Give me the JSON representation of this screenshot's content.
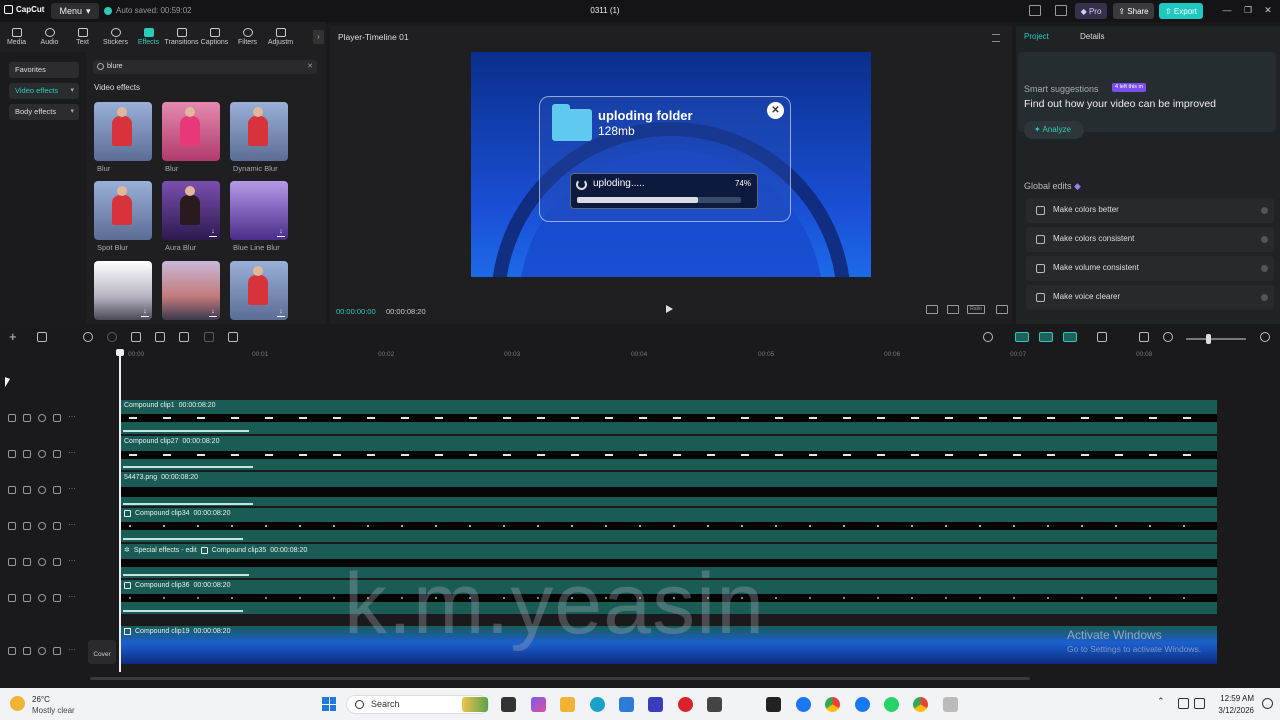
{
  "app": {
    "name": "CapCut",
    "menu_label": "Menu",
    "autosave": "Auto saved: 00:59:02",
    "project_title": "0311 (1)",
    "pro_label": "Pro",
    "share_label": "Share",
    "export_label": "Export"
  },
  "tool_tabs": [
    {
      "label": "Media",
      "icon": "media-icon"
    },
    {
      "label": "Audio",
      "icon": "audio-icon"
    },
    {
      "label": "Text",
      "icon": "text-icon"
    },
    {
      "label": "Stickers",
      "icon": "stickers-icon"
    },
    {
      "label": "Effects",
      "icon": "effects-icon",
      "active": true
    },
    {
      "label": "Transitions",
      "icon": "transitions-icon"
    },
    {
      "label": "Captions",
      "icon": "captions-icon"
    },
    {
      "label": "Filters",
      "icon": "filters-icon"
    },
    {
      "label": "Adjustm",
      "icon": "adjust-icon"
    }
  ],
  "categories": {
    "favorites": "Favorites",
    "video_effects": "Video effects",
    "body_effects": "Body effects"
  },
  "search": {
    "value": "blure"
  },
  "effects_section_title": "Video effects",
  "effects": [
    {
      "label": "Blur"
    },
    {
      "label": "Blur"
    },
    {
      "label": "Dynamic Blur"
    },
    {
      "label": "Spot Blur"
    },
    {
      "label": "Aura Blur"
    },
    {
      "label": "Blue Line Blur"
    },
    {
      "label": ""
    },
    {
      "label": ""
    },
    {
      "label": ""
    }
  ],
  "player": {
    "title": "Player-Timeline 01",
    "current_time": "00:00:00:00",
    "total_time": "00:00:08:20",
    "ratio_label": "Ratio"
  },
  "upload_dialog": {
    "title": "uploding folder",
    "size": "128mb",
    "status": "uploding.....",
    "percent_label": "74%",
    "progress": 0.74
  },
  "right_panel": {
    "tab_project": "Project",
    "tab_details": "Details",
    "suggest_title": "Smart suggestions",
    "suggest_badge": "4 left this m",
    "suggest_text": "Find out how your video can be improved",
    "analyze_label": "Analyze",
    "global_title": "Global edits",
    "global_items": [
      "Make colors better",
      "Make colors consistent",
      "Make volume consistent",
      "Make voice clearer"
    ]
  },
  "ruler_labels": [
    "00:00",
    "00:01",
    "00:02",
    "00:03",
    "00:04",
    "00:05",
    "00:06",
    "00:07",
    "00:08"
  ],
  "tracks": [
    {
      "label": "Compound clip1",
      "time": "00:00:08:20"
    },
    {
      "label": "Compound clip27",
      "time": "00:00:08:20"
    },
    {
      "label": "54473.png",
      "time": "00:00:08:20"
    },
    {
      "label": "Compound clip34",
      "time": "00:00:08:20"
    },
    {
      "label": "Compound clip35",
      "time": "00:00:08:20",
      "prefix": "Special effects - edit"
    },
    {
      "label": "Compound clip36",
      "time": "00:00:08:20"
    },
    {
      "label": "Compound clip19",
      "time": "00:00:08:20"
    }
  ],
  "cover_label": "Cover",
  "watermark": "k.m.yeasin",
  "activate": {
    "title": "Activate Windows",
    "subtitle": "Go to Settings to activate Windows."
  },
  "taskbar": {
    "temperature": "26°C",
    "condition": "Mostly clear",
    "search_placeholder": "Search",
    "time": "12:59 AM",
    "date": "3/12/2026"
  },
  "colors": {
    "accent": "#2ccbb6",
    "clip": "#1a5c55",
    "export": "#1fc7c0"
  }
}
